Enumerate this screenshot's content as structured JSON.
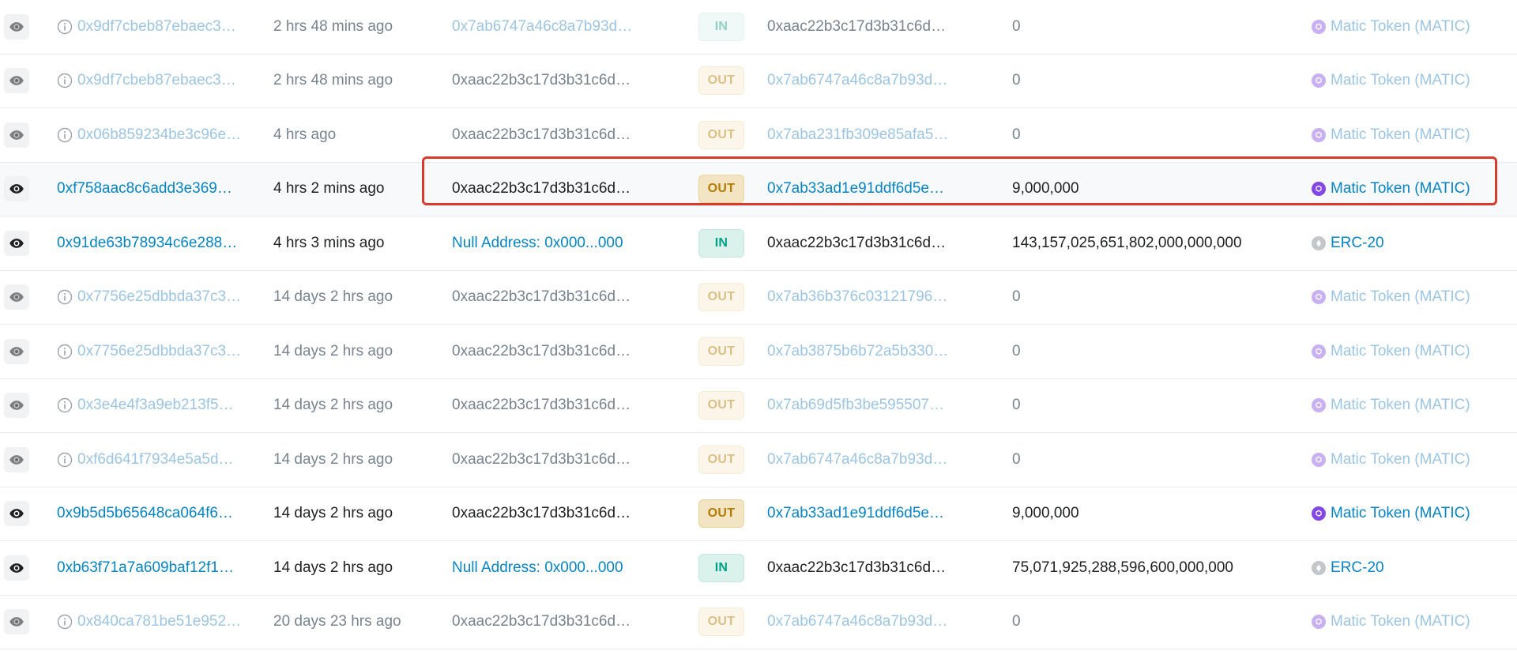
{
  "colors": {
    "link": "#0784c3",
    "in_badge": "#00a186",
    "out_badge": "#b47d00",
    "highlight": "#d93a2b",
    "matic": "#8247e5"
  },
  "rows": [
    {
      "hash": "0x9df7cbeb87ebaec3…",
      "age": "2 hrs 48 mins ago",
      "from": "0x7ab6747a46c8a7b93d…",
      "dir": "IN",
      "to": "0xaac22b3c17d3b31c6d…",
      "value": "0",
      "token": "Matic Token (MATIC)"
    },
    {
      "hash": "0x9df7cbeb87ebaec3…",
      "age": "2 hrs 48 mins ago",
      "from": "0xaac22b3c17d3b31c6d…",
      "dir": "OUT",
      "to": "0x7ab6747a46c8a7b93d…",
      "value": "0",
      "token": "Matic Token (MATIC)"
    },
    {
      "hash": "0x06b859234be3c96e…",
      "age": "4 hrs ago",
      "from": "0xaac22b3c17d3b31c6d…",
      "dir": "OUT",
      "to": "0x7aba231fb309e85afa5…",
      "value": "0",
      "token": "Matic Token (MATIC)"
    },
    {
      "hash": "0xf758aac8c6add3e369…",
      "age": "4 hrs 2 mins ago",
      "from": "0xaac22b3c17d3b31c6d…",
      "dir": "OUT",
      "to": "0x7ab33ad1e91ddf6d5e…",
      "value": "9,000,000",
      "token": "Matic Token (MATIC)"
    },
    {
      "hash": "0x91de63b78934c6e288…",
      "age": "4 hrs 3 mins ago",
      "from": "Null Address: 0x000...000",
      "dir": "IN",
      "to": "0xaac22b3c17d3b31c6d…",
      "value": "143,157,025,651,802,000,000,000",
      "token": "ERC-20"
    },
    {
      "hash": "0x7756e25dbbda37c3…",
      "age": "14 days 2 hrs ago",
      "from": "0xaac22b3c17d3b31c6d…",
      "dir": "OUT",
      "to": "0x7ab36b376c03121796…",
      "value": "0",
      "token": "Matic Token (MATIC)"
    },
    {
      "hash": "0x7756e25dbbda37c3…",
      "age": "14 days 2 hrs ago",
      "from": "0xaac22b3c17d3b31c6d…",
      "dir": "OUT",
      "to": "0x7ab3875b6b72a5b330…",
      "value": "0",
      "token": "Matic Token (MATIC)"
    },
    {
      "hash": "0x3e4e4f3a9eb213f5…",
      "age": "14 days 2 hrs ago",
      "from": "0xaac22b3c17d3b31c6d…",
      "dir": "OUT",
      "to": "0x7ab69d5fb3be595507…",
      "value": "0",
      "token": "Matic Token (MATIC)"
    },
    {
      "hash": "0xf6d641f7934e5a5d…",
      "age": "14 days 2 hrs ago",
      "from": "0xaac22b3c17d3b31c6d…",
      "dir": "OUT",
      "to": "0x7ab6747a46c8a7b93d…",
      "value": "0",
      "token": "Matic Token (MATIC)"
    },
    {
      "hash": "0x9b5d5b65648ca064f6…",
      "age": "14 days 2 hrs ago",
      "from": "0xaac22b3c17d3b31c6d…",
      "dir": "OUT",
      "to": "0x7ab33ad1e91ddf6d5e…",
      "value": "9,000,000",
      "token": "Matic Token (MATIC)"
    },
    {
      "hash": "0xb63f71a7a609baf12f1…",
      "age": "14 days 2 hrs ago",
      "from": "Null Address: 0x000...000",
      "dir": "IN",
      "to": "0xaac22b3c17d3b31c6d…",
      "value": "75,071,925,288,596,600,000,000",
      "token": "ERC-20"
    },
    {
      "hash": "0x840ca781be51e952…",
      "age": "20 days 23 hrs ago",
      "from": "0xaac22b3c17d3b31c6d…",
      "dir": "OUT",
      "to": "0x7ab6747a46c8a7b93d…",
      "value": "0",
      "token": "Matic Token (MATIC)"
    }
  ]
}
